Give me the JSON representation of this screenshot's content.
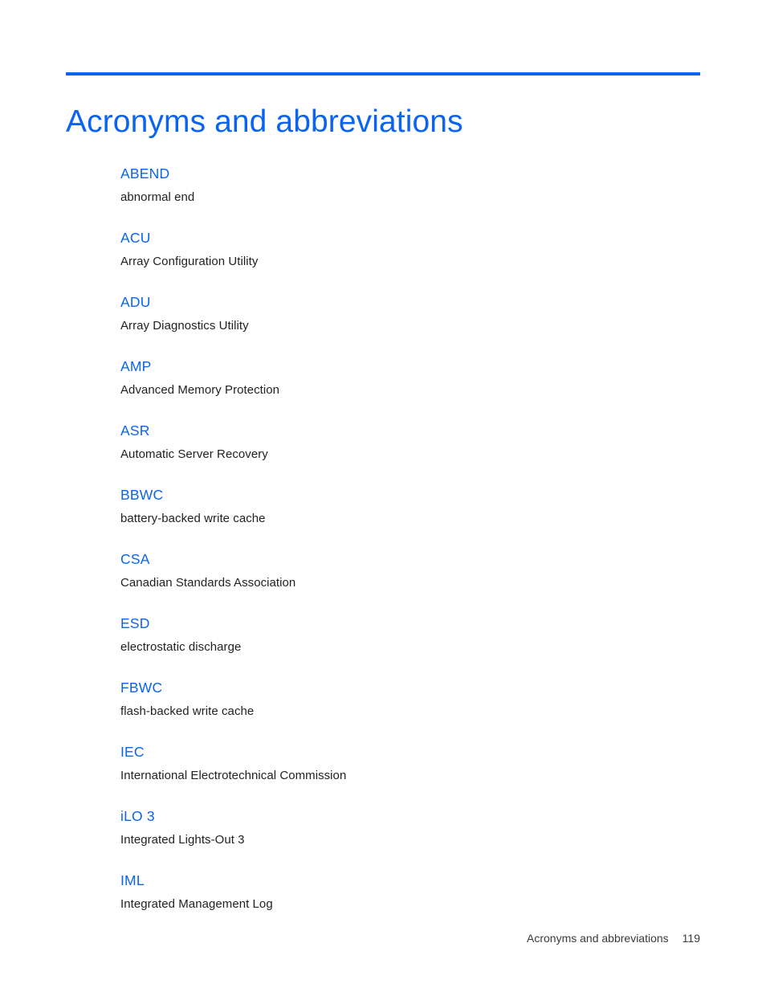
{
  "document": {
    "title": "Acronyms and abbreviations",
    "accent_color": "#0a64f0",
    "body_color": "#231f20"
  },
  "glossary": {
    "entries": [
      {
        "term": "ABEND",
        "definition": "abnormal end"
      },
      {
        "term": "ACU",
        "definition": "Array Configuration Utility"
      },
      {
        "term": "ADU",
        "definition": "Array Diagnostics Utility"
      },
      {
        "term": "AMP",
        "definition": "Advanced Memory Protection"
      },
      {
        "term": "ASR",
        "definition": "Automatic Server Recovery"
      },
      {
        "term": "BBWC",
        "definition": "battery-backed write cache"
      },
      {
        "term": "CSA",
        "definition": "Canadian Standards Association"
      },
      {
        "term": "ESD",
        "definition": "electrostatic discharge"
      },
      {
        "term": "FBWC",
        "definition": "flash-backed write cache"
      },
      {
        "term": "IEC",
        "definition": "International Electrotechnical Commission"
      },
      {
        "term": "iLO 3",
        "definition": "Integrated Lights-Out 3"
      },
      {
        "term": "IML",
        "definition": "Integrated Management Log"
      }
    ]
  },
  "footer": {
    "section_label": "Acronyms and abbreviations",
    "page_number": "119"
  }
}
